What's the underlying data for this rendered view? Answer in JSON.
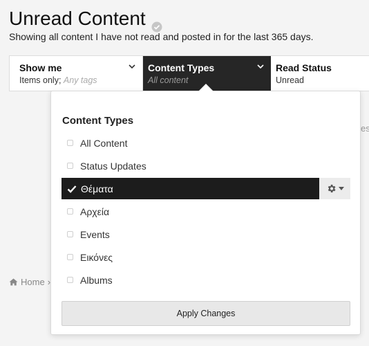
{
  "page": {
    "title": "Unread Content",
    "subtitle": "Showing all content I have not read and posted in for the last 365 days."
  },
  "filters": [
    {
      "title": "Show me",
      "value": "Items only;",
      "extra": "Any tags"
    },
    {
      "title": "Content Types",
      "value": "All content"
    },
    {
      "title": "Read Status",
      "value": "Unread"
    }
  ],
  "menu": {
    "heading": "Content Types",
    "items": [
      {
        "label": "All Content",
        "checked": false
      },
      {
        "label": "Status Updates",
        "checked": false
      },
      {
        "label": "Θέματα",
        "checked": true
      },
      {
        "label": "Αρχεία",
        "checked": false
      },
      {
        "label": "Events",
        "checked": false
      },
      {
        "label": "Εικόνες",
        "checked": false
      },
      {
        "label": "Albums",
        "checked": false
      }
    ],
    "apply_label": "Apply Changes"
  },
  "background": {
    "breadcrumb_home": "Home",
    "breadcrumb_sep": "›",
    "fragment": "es"
  },
  "icons": {
    "verified": "check-circle-icon",
    "chevron": "chevron-down-icon",
    "settings": "gear-icon",
    "home": "home-icon"
  },
  "colors": {
    "active_segment": "#262626",
    "selected_item": "#1c1c1c",
    "background": "#f4f4f4"
  }
}
